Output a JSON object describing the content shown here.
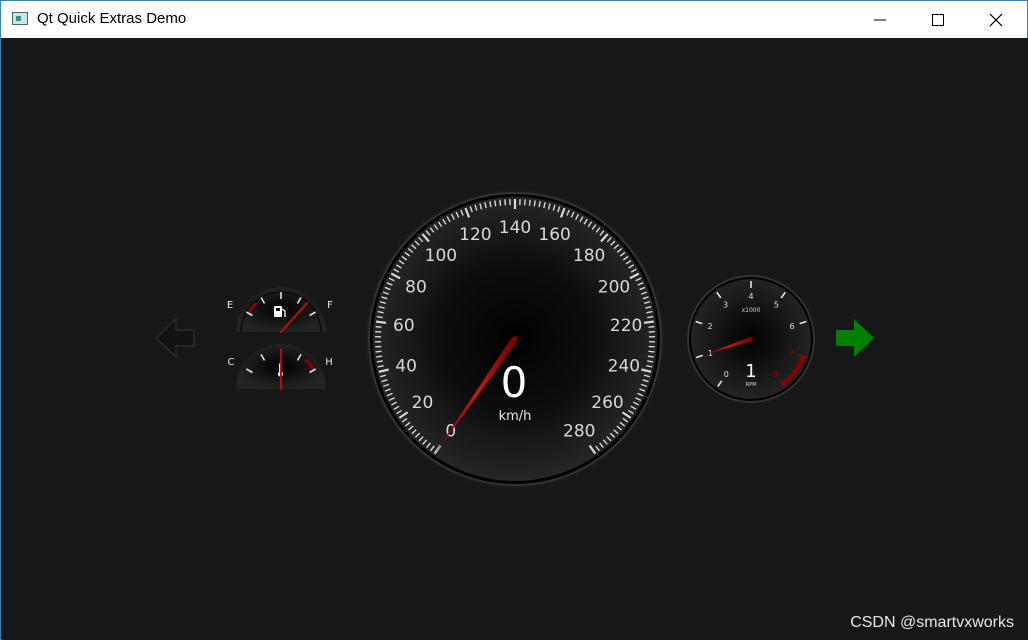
{
  "window": {
    "title": "Qt Quick Extras Demo",
    "controls": {
      "minimize_icon": "minimize-icon",
      "maximize_icon": "maximize-icon",
      "close_icon": "close-icon"
    }
  },
  "dashboard": {
    "left_turn_signal": {
      "icon": "left-arrow-icon",
      "active": false
    },
    "right_turn_signal": {
      "icon": "right-arrow-icon",
      "active": true,
      "color": "#008000"
    },
    "fuel_gauge": {
      "min_label": "E",
      "max_label": "F",
      "icon": "fuel-pump-icon",
      "value": 0.85
    },
    "temperature_gauge": {
      "min_label": "C",
      "max_label": "H",
      "icon": "thermometer-icon",
      "value": 0.5
    },
    "speedometer": {
      "value": "0",
      "unit": "km/h",
      "min": 0,
      "max": 280,
      "tick_labels": [
        "0",
        "20",
        "40",
        "60",
        "80",
        "100",
        "120",
        "140",
        "160",
        "180",
        "200",
        "220",
        "240",
        "260",
        "280"
      ]
    },
    "tachometer": {
      "value": "1",
      "unit": "RPM",
      "multiplier": "x1000",
      "min": 0,
      "max": 8,
      "redline": 7,
      "tick_labels": [
        "0",
        "1",
        "2",
        "3",
        "4",
        "5",
        "6",
        "7",
        "8"
      ]
    },
    "needle_color": "#b01010"
  },
  "watermark": "CSDN @smartvxworks"
}
